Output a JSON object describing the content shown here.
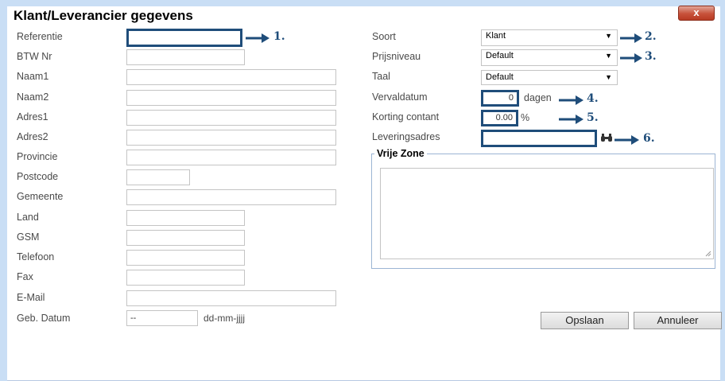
{
  "dialog": {
    "title": "Klant/Leverancier gegevens",
    "close_label": "x"
  },
  "left_fields": [
    {
      "label": "Referentie",
      "value": ""
    },
    {
      "label": "BTW Nr",
      "value": ""
    },
    {
      "label": "Naam1",
      "value": ""
    },
    {
      "label": "Naam2",
      "value": ""
    },
    {
      "label": "Adres1",
      "value": ""
    },
    {
      "label": "Adres2",
      "value": ""
    },
    {
      "label": "Provincie",
      "value": ""
    },
    {
      "label": "Postcode",
      "value": ""
    },
    {
      "label": "Gemeente",
      "value": ""
    },
    {
      "label": "Land",
      "value": ""
    },
    {
      "label": "GSM",
      "value": ""
    },
    {
      "label": "Telefoon",
      "value": ""
    },
    {
      "label": "Fax",
      "value": ""
    },
    {
      "label": "E-Mail",
      "value": ""
    },
    {
      "label": "Geb. Datum",
      "value": "--",
      "hint": "dd-mm-jjjj"
    }
  ],
  "right_fields": {
    "soort": {
      "label": "Soort",
      "value": "Klant"
    },
    "prijsniveau": {
      "label": "Prijsniveau",
      "value": "Default"
    },
    "taal": {
      "label": "Taal",
      "value": "Default"
    },
    "vervaldatum": {
      "label": "Vervaldatum",
      "value": "0",
      "unit": "dagen"
    },
    "korting": {
      "label": "Korting contant",
      "value": "0.00",
      "unit": "%"
    },
    "leveringsadres": {
      "label": "Leveringsadres",
      "value": ""
    }
  },
  "vrije_zone": {
    "legend": "Vrije Zone",
    "value": ""
  },
  "annotations": [
    "1.",
    "2.",
    "3.",
    "4.",
    "5.",
    "6."
  ],
  "buttons": {
    "save": "Opslaan",
    "cancel": "Annuleer"
  },
  "colors": {
    "frame": "#c9def5",
    "highlight": "#1f4d7a",
    "close": "#c7513a"
  },
  "icons": {
    "leveringsadres_lookup": "binoculars-icon",
    "caret": "chevron-down-icon",
    "annotation_arrow": "arrow-right-icon"
  }
}
